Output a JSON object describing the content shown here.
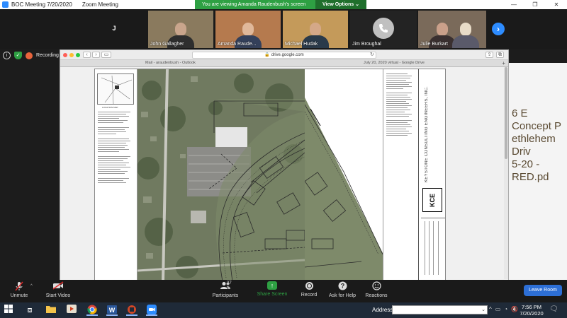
{
  "window": {
    "tab1_title": "BOC Meeting 7/20/2020",
    "app_title": "Zoom Meeting",
    "minimize": "—",
    "maximize": "❐",
    "close": "✕"
  },
  "banner": {
    "viewing_text": "You are viewing Amanda Raudenbush's screen",
    "view_options": "View Options ⌄"
  },
  "participants_strip": [
    {
      "name": "",
      "initial": "J",
      "type": "initial"
    },
    {
      "name": "John Gallagher",
      "type": "video"
    },
    {
      "name": "Amanda Raude...",
      "type": "video"
    },
    {
      "name": "Michael Hudak",
      "type": "video"
    },
    {
      "name": "Jim Broughal",
      "type": "phone"
    },
    {
      "name": "Julie Burkart",
      "type": "video"
    }
  ],
  "recording": {
    "label": "Recording"
  },
  "browser": {
    "url": "drive.google.com",
    "tab_left": "Mail - araudenbush - Outlook",
    "tab_right": "July 20, 2020 virtual - Google Drive",
    "new_tab": "+"
  },
  "drawing": {
    "firm_name": "KEYSTONE CONSULTING ENGINEERS, INC.",
    "logo_text": "KCE",
    "location_map_label": "LOCATION MAP"
  },
  "background_doc": {
    "title_lines": [
      "6 E Concept P",
      "ethlehem Driv",
      "5-20 -RED.pd"
    ]
  },
  "toolbar": {
    "unmute": "Unmute",
    "start_video": "Start Video",
    "participants": "Participants",
    "participants_count": "27",
    "share_screen": "Share Screen",
    "record": "Record",
    "ask_for_help": "Ask for Help",
    "reactions": "Reactions",
    "leave_room": "Leave Room"
  },
  "taskbar": {
    "address_label": "Address",
    "time": "7:56 PM",
    "date": "7/20/2020"
  },
  "colors": {
    "zoom_blue": "#2d8cff",
    "banner_green": "#2ea043",
    "leave_blue": "#2d6fd6",
    "taskbar": "#1f2a38"
  }
}
